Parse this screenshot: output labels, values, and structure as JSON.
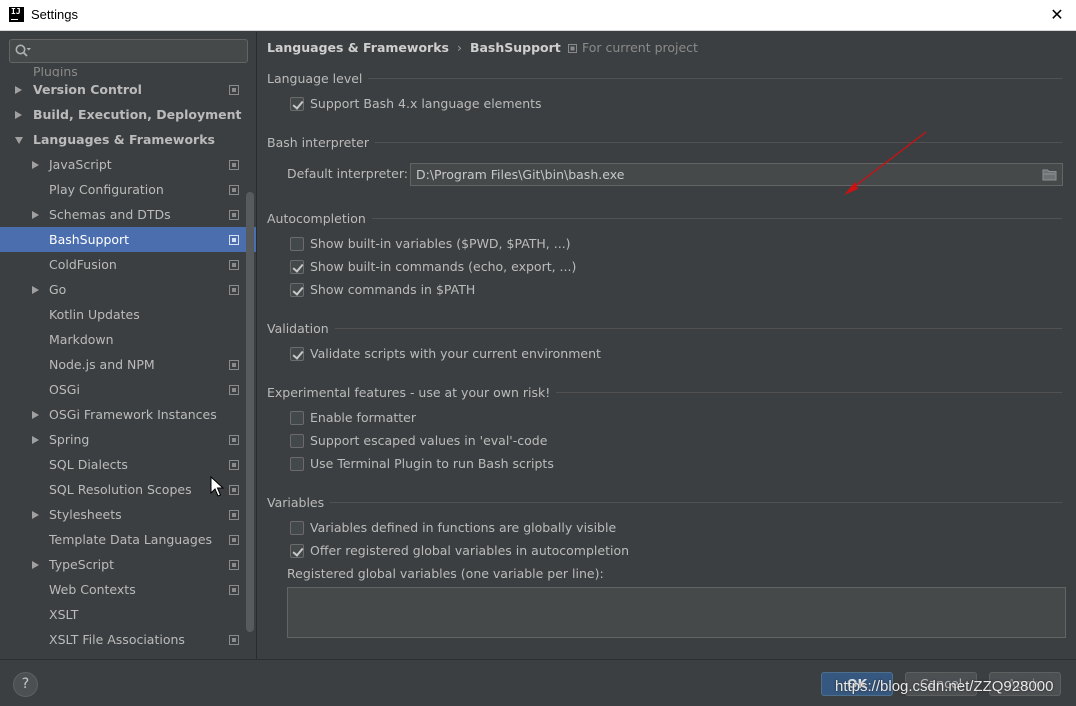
{
  "window": {
    "title": "Settings"
  },
  "search": {
    "placeholder": ""
  },
  "tree": {
    "partial_label": "Plugins",
    "items": [
      {
        "label": "Version Control",
        "level": 0,
        "arrow": "right",
        "project_icon": true
      },
      {
        "label": "Build, Execution, Deployment",
        "level": 0,
        "arrow": "right",
        "project_icon": false
      },
      {
        "label": "Languages & Frameworks",
        "level": 0,
        "arrow": "down",
        "project_icon": false
      },
      {
        "label": "JavaScript",
        "level": 1,
        "arrow": "right",
        "project_icon": true
      },
      {
        "label": "Play Configuration",
        "level": 1,
        "arrow": "none",
        "project_icon": true
      },
      {
        "label": "Schemas and DTDs",
        "level": 1,
        "arrow": "right",
        "project_icon": true
      },
      {
        "label": "BashSupport",
        "level": 1,
        "arrow": "none",
        "project_icon": true,
        "selected": true
      },
      {
        "label": "ColdFusion",
        "level": 1,
        "arrow": "none",
        "project_icon": true
      },
      {
        "label": "Go",
        "level": 1,
        "arrow": "right",
        "project_icon": true
      },
      {
        "label": "Kotlin Updates",
        "level": 1,
        "arrow": "none",
        "project_icon": false
      },
      {
        "label": "Markdown",
        "level": 1,
        "arrow": "none",
        "project_icon": false
      },
      {
        "label": "Node.js and NPM",
        "level": 1,
        "arrow": "none",
        "project_icon": true
      },
      {
        "label": "OSGi",
        "level": 1,
        "arrow": "none",
        "project_icon": true
      },
      {
        "label": "OSGi Framework Instances",
        "level": 1,
        "arrow": "right",
        "project_icon": false
      },
      {
        "label": "Spring",
        "level": 1,
        "arrow": "right",
        "project_icon": true
      },
      {
        "label": "SQL Dialects",
        "level": 1,
        "arrow": "none",
        "project_icon": true
      },
      {
        "label": "SQL Resolution Scopes",
        "level": 1,
        "arrow": "none",
        "project_icon": true
      },
      {
        "label": "Stylesheets",
        "level": 1,
        "arrow": "right",
        "project_icon": true
      },
      {
        "label": "Template Data Languages",
        "level": 1,
        "arrow": "none",
        "project_icon": true
      },
      {
        "label": "TypeScript",
        "level": 1,
        "arrow": "right",
        "project_icon": true
      },
      {
        "label": "Web Contexts",
        "level": 1,
        "arrow": "none",
        "project_icon": true
      },
      {
        "label": "XSLT",
        "level": 1,
        "arrow": "none",
        "project_icon": false
      },
      {
        "label": "XSLT File Associations",
        "level": 1,
        "arrow": "none",
        "project_icon": true
      }
    ]
  },
  "header": {
    "crumb1": "Languages & Frameworks",
    "separator": "›",
    "crumb2": "BashSupport",
    "for_project": "For current project"
  },
  "sections": {
    "language_level": {
      "title": "Language level",
      "support_bash4": {
        "label": "Support Bash 4.x language elements",
        "checked": true
      }
    },
    "bash_interpreter": {
      "title": "Bash interpreter",
      "default_label": "Default interpreter:",
      "default_value": "D:\\Program Files\\Git\\bin\\bash.exe"
    },
    "autocompletion": {
      "title": "Autocompletion",
      "items": [
        {
          "label": "Show built-in variables ($PWD, $PATH, ...)",
          "checked": false
        },
        {
          "label": "Show built-in commands (echo, export, ...)",
          "checked": true
        },
        {
          "label": "Show commands in $PATH",
          "checked": true
        }
      ]
    },
    "validation": {
      "title": "Validation",
      "items": [
        {
          "label": "Validate scripts with your current environment",
          "checked": true
        }
      ]
    },
    "experimental": {
      "title": "Experimental features - use at your own risk!",
      "items": [
        {
          "label": "Enable formatter",
          "checked": false
        },
        {
          "label": "Support escaped values in 'eval'-code",
          "checked": false
        },
        {
          "label": "Use Terminal Plugin to run Bash scripts",
          "checked": false
        }
      ]
    },
    "variables": {
      "title": "Variables",
      "items": [
        {
          "label": "Variables defined in functions are globally visible",
          "checked": false
        },
        {
          "label": "Offer registered global variables in autocompletion",
          "checked": true
        }
      ],
      "registered_label": "Registered global variables (one variable per line):",
      "registered_value": ""
    }
  },
  "footer": {
    "help_label": "?",
    "ok_label": "OK",
    "cancel_label": "Cancel",
    "apply_label": "Apply",
    "watermark": "https://blog.csdn.net/ZZQ928000"
  },
  "colors": {
    "background": "#3c3f41",
    "selection": "#4b6eaf",
    "ok_button": "#365880",
    "annotation_arrow": "#cc1111"
  }
}
